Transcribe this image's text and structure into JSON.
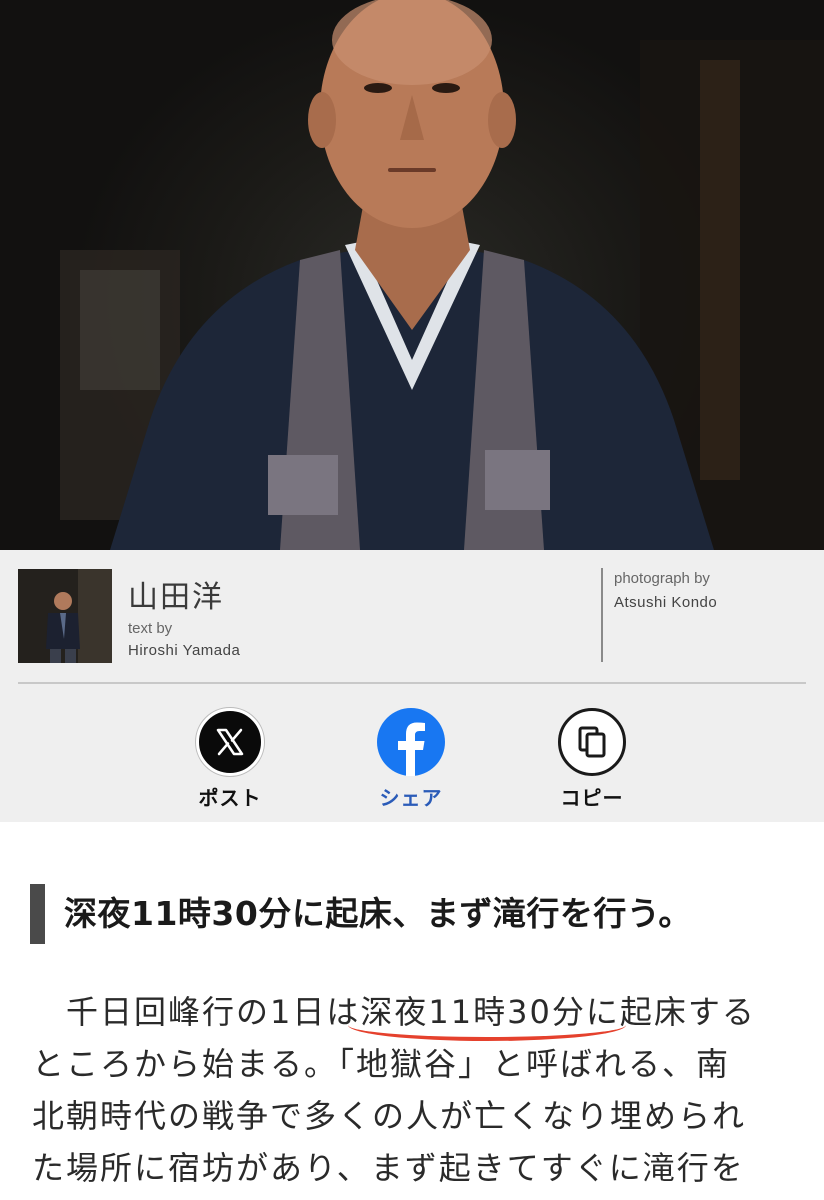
{
  "hero": {
    "photo_alt": "Portrait of a monk in dark robe"
  },
  "credit": {
    "author_name_ja": "山田洋",
    "text_by_label": "text by",
    "author_name_roman": "Hiroshi Yamada",
    "photograph_by_label": "photograph by",
    "photographer_name": "Atsushi Kondo"
  },
  "share": {
    "x_label": "ポスト",
    "facebook_label": "シェア",
    "copy_label": "コピー"
  },
  "article": {
    "heading": "深夜11時30分に起床、まず滝行を行う。",
    "para_line1_a": "千日回峰行の1日は",
    "para_line1_highlight": "深夜11時30分",
    "para_line1_b": "に起床する",
    "para_line2": "ところから始まる。「地獄谷」と呼ばれる、南",
    "para_line3": "北朝時代の戦争で多くの人が亡くなり埋められ",
    "para_line4": "た場所に宿坊があり、まず起きてすぐに滝行を"
  },
  "colors": {
    "facebook_blue": "#1877f2",
    "facebook_label": "#2a5bb8",
    "underline_red": "#e5412d",
    "heading_bar": "#4a4a4a",
    "credit_bg": "#efefef"
  }
}
